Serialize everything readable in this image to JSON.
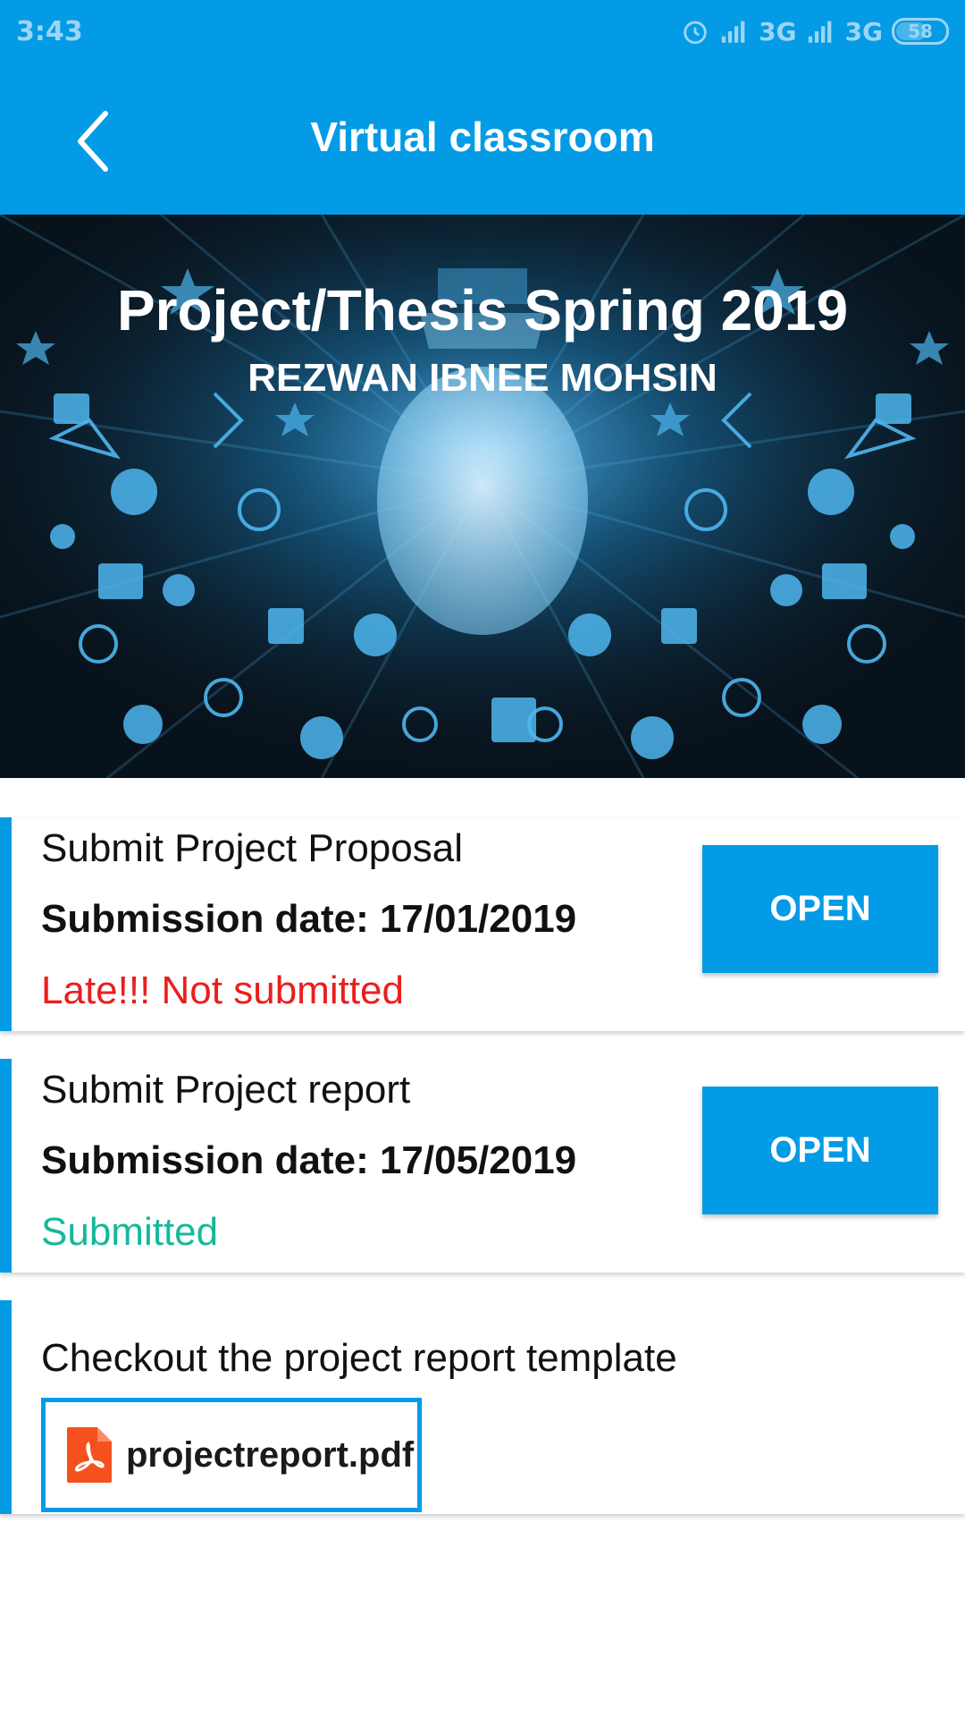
{
  "status_bar": {
    "time": "3:43",
    "network_1": "3G",
    "network_2": "3G",
    "battery": "58"
  },
  "app_bar": {
    "title": "Virtual classroom",
    "back_icon": "chevron-left-icon"
  },
  "banner": {
    "title": "Project/Thesis Spring 2019",
    "subtitle": "REZWAN IBNEE MOHSIN"
  },
  "assignments": [
    {
      "title": "Submit Project Proposal",
      "date": "Submission date: 17/01/2019",
      "status": "Late!!! Not submitted",
      "status_color": "#ea1e1e",
      "button": "OPEN"
    },
    {
      "title": "Submit Project report",
      "date": "Submission date: 17/05/2019",
      "status": "Submitted",
      "status_color": "#16b89a",
      "button": "OPEN"
    }
  ],
  "template_card": {
    "title": "Checkout the project report template",
    "file_name": "projectreport.pdf",
    "file_icon": "pdf-file-icon"
  },
  "colors": {
    "primary": "#039be5",
    "late": "#ea1e1e",
    "submitted": "#16b89a",
    "pdf": "#f4511e"
  }
}
